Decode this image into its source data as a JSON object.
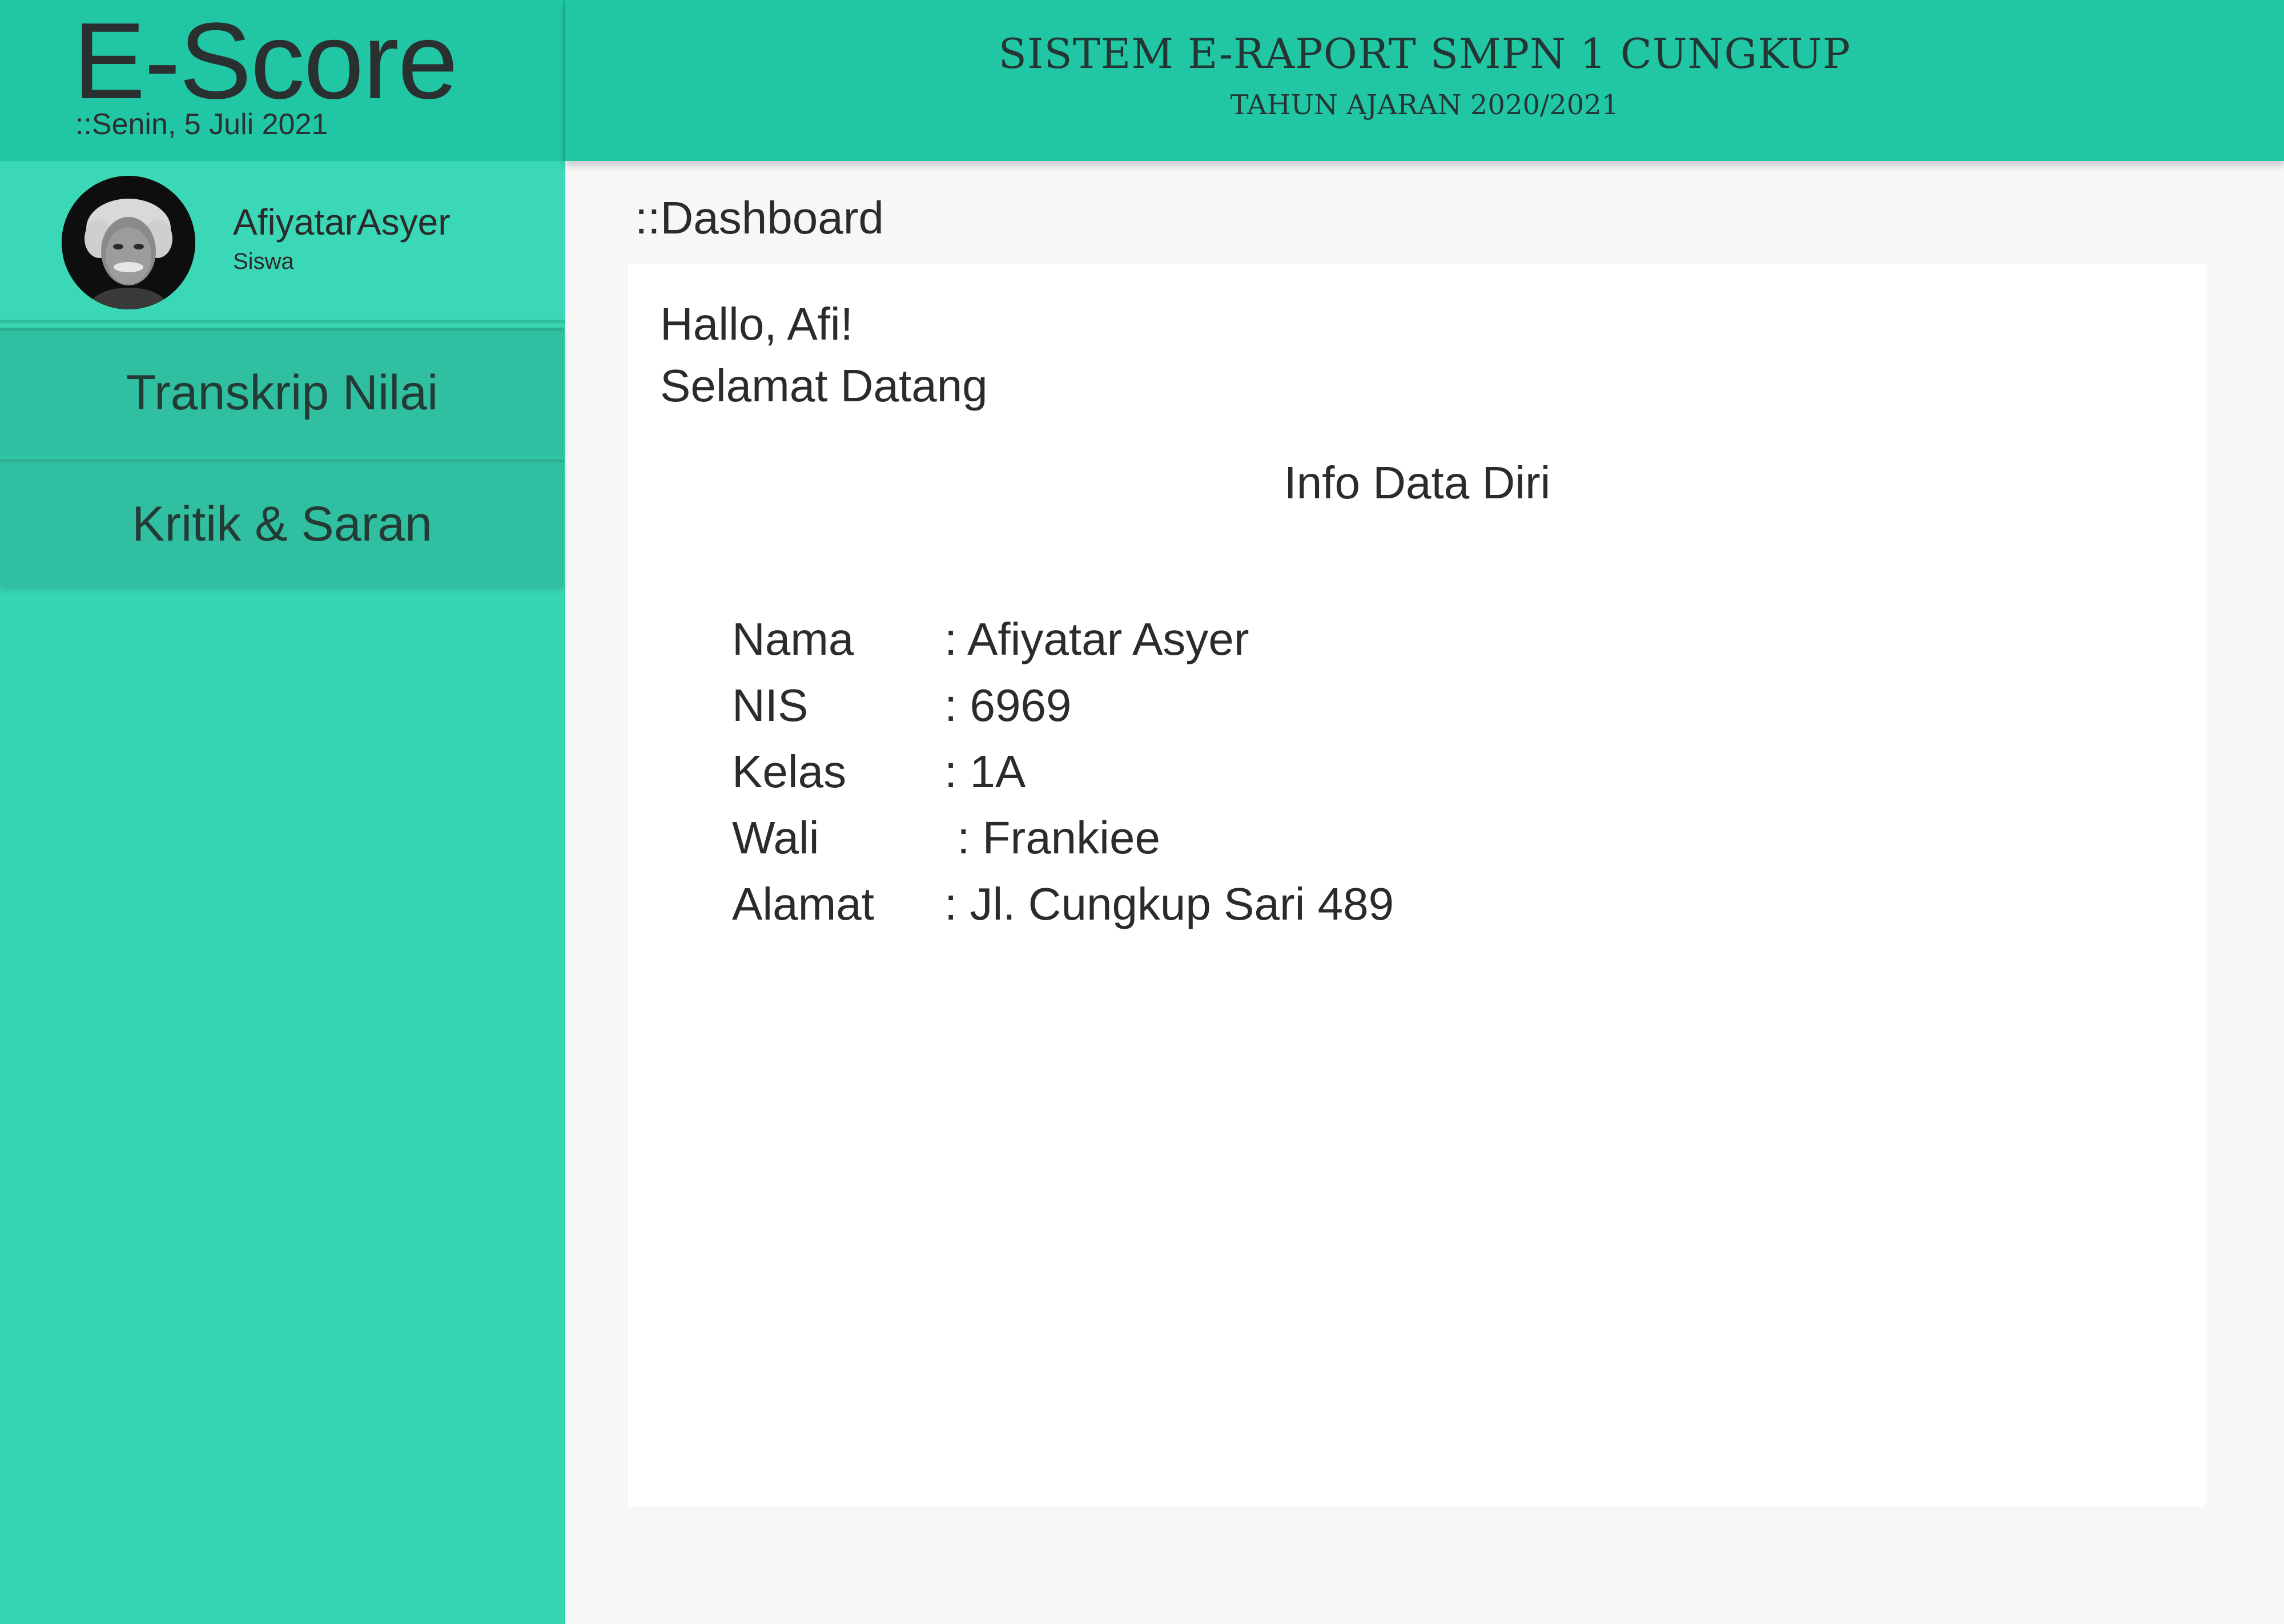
{
  "brand": {
    "title": "E-Score",
    "date": "::Senin, 5 Juli 2021"
  },
  "header": {
    "title": "SISTEM E-RAPORT SMPN 1 CUNGKUP",
    "subtitle": "TAHUN AJARAN 2020/2021"
  },
  "profile": {
    "name": "AfiyatarAsyer",
    "role": "Siswa"
  },
  "sidebar": {
    "items": [
      {
        "label": "Transkrip Nilai"
      },
      {
        "label": "Kritik & Saran"
      }
    ]
  },
  "main": {
    "page_title": "::Dashboard",
    "greeting": "Hallo, Afi!",
    "welcome": "Selamat Datang",
    "info_title": "Info Data Diri",
    "fields": [
      {
        "label": "Nama",
        "value": ": Afiyatar Asyer"
      },
      {
        "label": "NIS",
        "value": ": 6969"
      },
      {
        "label": "Kelas",
        "value": ": 1A"
      },
      {
        "label": "Wali",
        "value": " : Frankiee"
      },
      {
        "label": "Alamat",
        "value": ": Jl. Cungkup Sari 489"
      }
    ]
  },
  "colors": {
    "header": "#21c7a4",
    "sidebar": "#36d6b3",
    "menu": "#30bfa0",
    "background": "#f7f7f7",
    "panel": "#ffffff"
  }
}
